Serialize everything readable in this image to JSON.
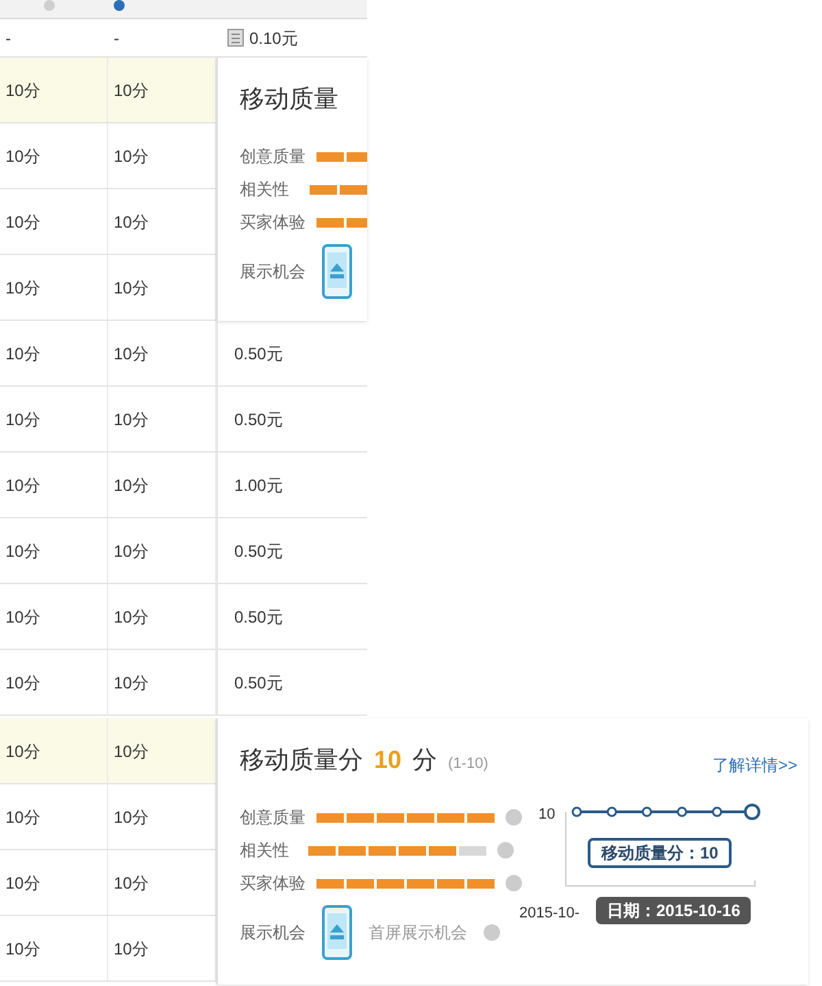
{
  "first_row": {
    "cells": [
      "-",
      "-"
    ],
    "price": "0.10元"
  },
  "section_top": {
    "rows": [
      {
        "cells": [
          "10分",
          "10分"
        ],
        "highlighted": true
      },
      {
        "cells": [
          "10分",
          "10分"
        ],
        "highlighted": false
      },
      {
        "cells": [
          "10分",
          "10分"
        ],
        "highlighted": false
      },
      {
        "cells": [
          "10分",
          "10分"
        ],
        "highlighted": false
      },
      {
        "cells": [
          "10分",
          "10分"
        ],
        "highlighted": false,
        "price": "0.50元"
      },
      {
        "cells": [
          "10分",
          "10分"
        ],
        "highlighted": false,
        "price": "0.50元"
      },
      {
        "cells": [
          "10分",
          "10分"
        ],
        "highlighted": false,
        "price": "1.00元"
      },
      {
        "cells": [
          "10分",
          "10分"
        ],
        "highlighted": false,
        "price": "0.50元"
      },
      {
        "cells": [
          "10分",
          "10分"
        ],
        "highlighted": false,
        "price": "0.50元"
      },
      {
        "cells": [
          "10分",
          "10分"
        ],
        "highlighted": false,
        "price": "0.50元"
      }
    ],
    "popup": {
      "title": "移动质量",
      "metrics": [
        {
          "label": "创意质量"
        },
        {
          "label": "相关性"
        },
        {
          "label": "买家体验"
        }
      ],
      "exposure_label": "展示机会"
    }
  },
  "section_bottom": {
    "rows": [
      {
        "cells": [
          "10分",
          "10分"
        ],
        "highlighted": true
      },
      {
        "cells": [
          "10分",
          "10分"
        ],
        "highlighted": false
      },
      {
        "cells": [
          "10分",
          "10分"
        ],
        "highlighted": false
      },
      {
        "cells": [
          "10分",
          "10分"
        ],
        "highlighted": false
      }
    ],
    "popup": {
      "title": "移动质量分",
      "score": "10",
      "unit": "分",
      "range": "(1-10)",
      "link": "了解详情>>",
      "metrics": [
        {
          "label": "创意质量",
          "segments": [
            {
              "filled": true
            },
            {
              "filled": true
            },
            {
              "filled": true
            },
            {
              "filled": true
            },
            {
              "filled": true
            },
            {
              "filled": true
            }
          ]
        },
        {
          "label": "相关性",
          "segments": [
            {
              "filled": true
            },
            {
              "filled": true
            },
            {
              "filled": true
            },
            {
              "filled": true
            },
            {
              "filled": true
            },
            {
              "filled": false
            }
          ]
        },
        {
          "label": "买家体验",
          "segments": [
            {
              "filled": true
            },
            {
              "filled": true
            },
            {
              "filled": true
            },
            {
              "filled": true
            },
            {
              "filled": true
            },
            {
              "filled": true
            }
          ]
        }
      ],
      "exposure_label": "展示机会",
      "exposure_text": "首屏展示机会",
      "chart": {
        "y_label": "10",
        "x_label": "2015-10-"
      },
      "tooltip_value": "移动质量分：10",
      "tooltip_date": "日期：2015-10-16"
    }
  }
}
